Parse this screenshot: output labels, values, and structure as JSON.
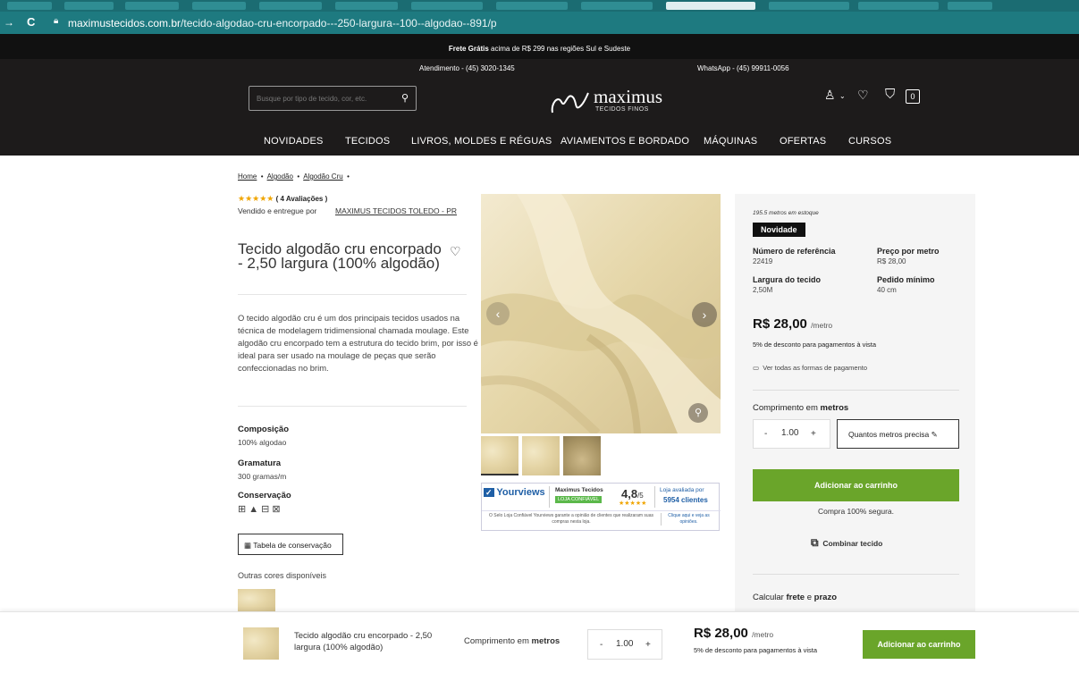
{
  "browser": {
    "url_domain": "maximustecidos.com.br",
    "url_path": "/tecido-algodao-cru-encorpado---250-largura--100--algodao--891/p"
  },
  "topbar": {
    "free_shipping_bold": "Frete Grátis",
    "free_shipping_rest": "acima de R$ 299 nas regiões Sul e Sudeste",
    "phone": "Atendimento - (45) 3020-1345",
    "whatsapp": "WhatsApp - (45) 99911-0056"
  },
  "header": {
    "search_placeholder": "Busque por tipo de tecido, cor, etc.",
    "logo_name": "maximus",
    "logo_tagline": "TECIDOS FINOS",
    "cart_count": "0"
  },
  "nav": [
    "NOVIDADES",
    "TECIDOS",
    "LIVROS, MOLDES E RÉGUAS",
    "AVIAMENTOS E BORDADO",
    "MÁQUINAS",
    "OFERTAS",
    "CURSOS"
  ],
  "breadcrumb": [
    "Home",
    "Algodão",
    "Algodão Cru"
  ],
  "product": {
    "rating_text": "( 4 Avaliações )",
    "sold_by_label": "Vendido e entregue por",
    "seller": "MAXIMUS TECIDOS TOLEDO - PR",
    "title": "Tecido algodão cru encorpado - 2,50 largura (100% algodão)",
    "description": "O tecido algodão cru é um dos principais tecidos usados na técnica de modelagem tridimensional chamada moulage. Este algodão cru encorpado tem a estrutura do tecido brim, por isso é ideal para ser usado na moulage de peças que serão confeccionadas no brim.",
    "composition_label": "Composição",
    "composition_value": "100% algodao",
    "weight_label": "Gramatura",
    "weight_value": "300 gramas/m",
    "care_label": "Conservação",
    "care_table_button": "Tabela de conservação",
    "other_colors_label": "Outras cores disponíveis"
  },
  "yourviews": {
    "brand": "Yourviews",
    "store": "Maximus Tecidos",
    "seal": "LOJA CONFIÁVEL",
    "score": "4,8",
    "score_max": "/5",
    "rated_by": "Loja avaliada por",
    "clients": "5954 clientes",
    "footer_text": "O Selo Loja Confiável Yourviews garante a opinião de clientes que realizaram suas compras nesta loja.",
    "footer_link": "Clique aqui e veja as opiniões."
  },
  "buybox": {
    "stock": "195.5 metros em estoque",
    "badge": "Novidade",
    "ref_label": "Número de referência",
    "ref_value": "22419",
    "price_per_label": "Preço por metro",
    "price_per_value": "R$ 28,00",
    "width_label": "Largura do tecido",
    "width_value": "2,50M",
    "min_label": "Pedido mínimo",
    "min_value": "40 cm",
    "price": "R$ 28,00",
    "price_unit": "/metro",
    "discount": "5% de desconto para pagamentos à vista",
    "payment_link": "Ver todas as formas de pagamento",
    "length_label": "Comprimento em",
    "length_unit": "metros",
    "qty_minus": "-",
    "qty": "1.00",
    "qty_plus": "+",
    "how_many": "Quantos metros precisa",
    "add_to_cart": "Adicionar ao carrinho",
    "secure": "Compra 100% segura.",
    "combine": "Combinar tecido",
    "shipping_calc": "Calcular",
    "shipping_bold1": "frete",
    "shipping_mid": "e",
    "shipping_bold2": "prazo"
  },
  "sticky": {
    "title": "Tecido algodão cru encorpado - 2,50 largura (100% algodão)",
    "length_label": "Comprimento em",
    "length_unit": "metros",
    "qty_minus": "-",
    "qty": "1.00",
    "qty_plus": "+",
    "price": "R$ 28,00",
    "price_unit": "/metro",
    "discount": "5% de desconto para pagamentos à vista",
    "add_to_cart": "Adicionar ao carrinho"
  },
  "colors": {
    "green": "#6aa52a",
    "header": "#1d1b1b",
    "chrome": "#1e7a80",
    "stars": "#f0a500"
  }
}
